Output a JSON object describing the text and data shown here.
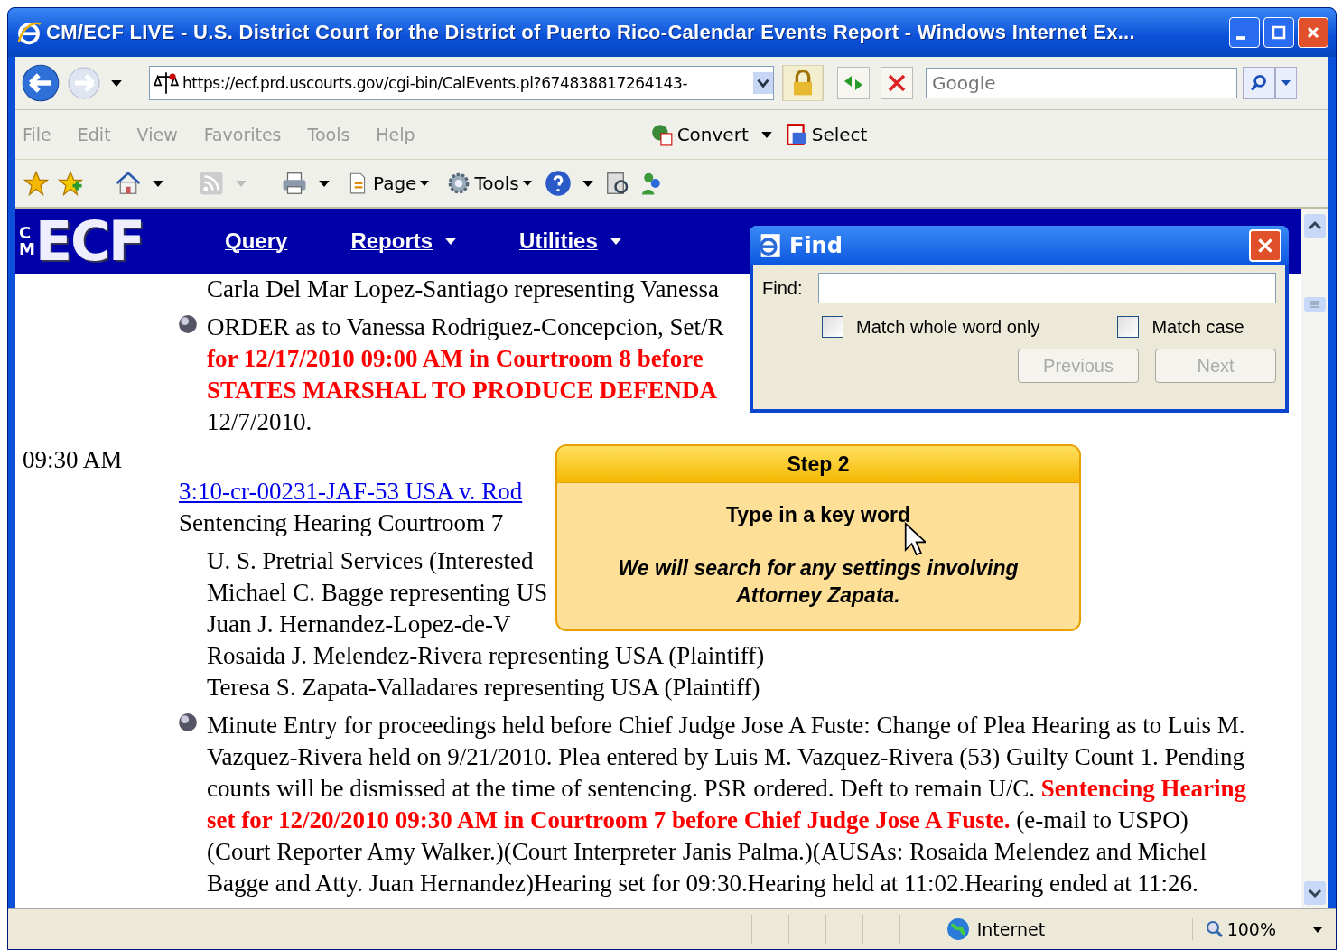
{
  "window": {
    "title": "CM/ECF LIVE - U.S. District Court for the District of Puerto Rico-Calendar Events Report - Windows Internet Ex..."
  },
  "address_bar": {
    "url": "https://ecf.prd.uscourts.gov/cgi-bin/CalEvents.pl?674838817264143-"
  },
  "search": {
    "placeholder": "Google"
  },
  "menu_bar": [
    "File",
    "Edit",
    "View",
    "Favorites",
    "Tools",
    "Help"
  ],
  "addon_buttons": [
    "Convert",
    "Select"
  ],
  "command_bar": [
    "Page",
    "Tools"
  ],
  "site_nav": {
    "logo": "ECF",
    "logo_side": "CM",
    "items": [
      {
        "label": "Query",
        "dropdown": false
      },
      {
        "label": "Reports",
        "dropdown": true
      },
      {
        "label": "Utilities",
        "dropdown": true
      }
    ]
  },
  "content": [
    {
      "kind": "party",
      "text": "Carla Del Mar Lopez-Santiago representing Vanessa"
    },
    {
      "kind": "entry",
      "lines": [
        [
          {
            "text": "ORDER as to Vanessa Rodriguez-Concepcion, Set/R",
            "red": false
          }
        ],
        [
          {
            "text": "for 12/17/2010 09:00 AM in Courtroom 8 before",
            "red": true
          }
        ],
        [
          {
            "text": "STATES MARSHAL TO PRODUCE DEFENDA",
            "red": true
          }
        ],
        [
          {
            "text": "12/7/2010.",
            "red": false
          }
        ]
      ]
    },
    {
      "kind": "time",
      "text": "09:30 AM"
    },
    {
      "kind": "case_link",
      "text": "3:10-cr-00231-JAF-53 USA v. Rod"
    },
    {
      "kind": "event",
      "text": "Sentencing Hearing Courtroom 7"
    },
    {
      "kind": "party",
      "text": "U. S. Pretrial Services (Interested"
    },
    {
      "kind": "party",
      "text": "Michael C. Bagge representing US"
    },
    {
      "kind": "party",
      "text": "Juan J. Hernandez-Lopez-de-V"
    },
    {
      "kind": "party",
      "text": "Rosaida J. Melendez-Rivera representing USA (Plaintiff)"
    },
    {
      "kind": "party",
      "text": "Teresa S. Zapata-Valladares representing USA (Plaintiff)"
    },
    {
      "kind": "entry",
      "lines": [
        [
          {
            "text": "Minute Entry for proceedings held before Chief Judge Jose A Fuste: Change of Plea Hearing as to Luis M.",
            "red": false
          }
        ],
        [
          {
            "text": "Vazquez-Rivera held on 9/21/2010. Plea entered by Luis M. Vazquez-Rivera (53) Guilty Count 1. Pending",
            "red": false
          }
        ],
        [
          {
            "text": "counts will be dismissed at the time of sentencing. PSR ordered. Deft to remain U/C. ",
            "red": false
          },
          {
            "text": "Sentencing Hearing",
            "red": true
          }
        ],
        [
          {
            "text": "set for 12/20/2010 09:30 AM in Courtroom 7 before Chief Judge Jose A Fuste.",
            "red": true
          },
          {
            "text": " (e-mail to USPO)",
            "red": false
          }
        ],
        [
          {
            "text": "(Court Reporter Amy Walker.)(Court Interpreter Janis Palma.)(AUSAs: Rosaida Melendez and Michel",
            "red": false
          }
        ],
        [
          {
            "text": "Bagge and Atty. Juan Hernandez)Hearing set for 09:30.Hearing held at 11:02.Hearing ended at 11:26.",
            "red": false
          }
        ]
      ]
    }
  ],
  "find_dialog": {
    "title": "Find",
    "label": "Find:",
    "options": [
      {
        "label": "Match whole word only",
        "checked": false
      },
      {
        "label": "Match case",
        "checked": false
      }
    ],
    "buttons": [
      {
        "label": "Previous",
        "disabled": true
      },
      {
        "label": "Next",
        "disabled": true
      }
    ]
  },
  "callout": {
    "title": "Step 2",
    "heading": "Type in a key word",
    "note": "We will search for any settings involving Attorney Zapata."
  },
  "status_bar": {
    "zone": "Internet",
    "zoom": "100%"
  }
}
